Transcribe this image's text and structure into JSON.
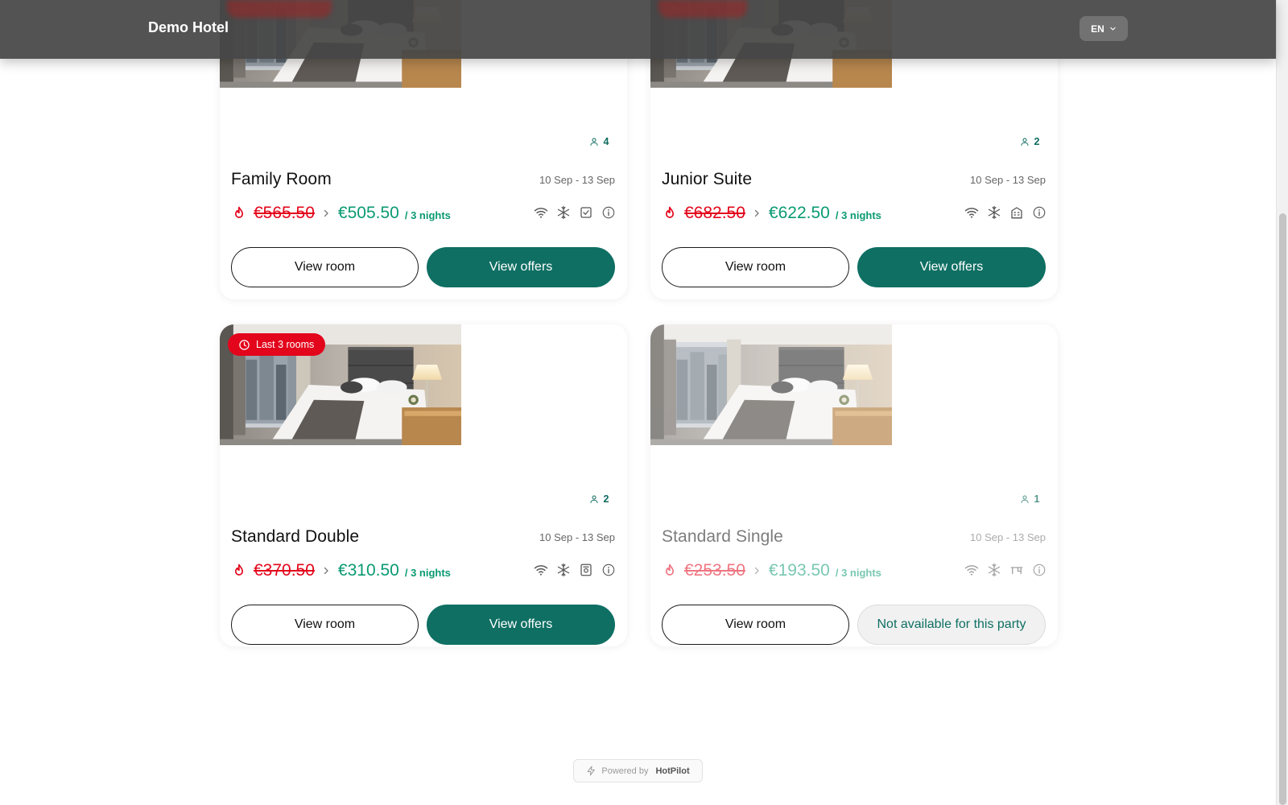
{
  "header": {
    "brand": "Demo Hotel",
    "language": "EN"
  },
  "colors": {
    "accent": "#0f6f63",
    "price_new": "#0a9a72",
    "price_old": "#e3051b",
    "badge": "#e3051b",
    "header_bg": "#464646"
  },
  "rooms": [
    {
      "title": "Family Room",
      "dates": "10 Sep - 13 Sep",
      "old_price": "€565.50",
      "new_price": "€505.50",
      "nights": "/ 3 nights",
      "guests": "4",
      "amenities": [
        "wifi-icon",
        "snowflake-icon",
        "checkbox-icon",
        "info-icon"
      ],
      "view_label": "View room",
      "action_label": "View offers",
      "available": true
    },
    {
      "title": "Junior Suite",
      "dates": "10 Sep - 13 Sep",
      "old_price": "€682.50",
      "new_price": "€622.50",
      "nights": "/ 3 nights",
      "guests": "2",
      "amenities": [
        "wifi-icon",
        "snowflake-icon",
        "building-icon",
        "info-icon"
      ],
      "view_label": "View room",
      "action_label": "View offers",
      "available": true
    },
    {
      "title": "Standard Double",
      "dates": "10 Sep - 13 Sep",
      "old_price": "€370.50",
      "new_price": "€310.50",
      "nights": "/ 3 nights",
      "guests": "2",
      "badge": "Last 3 rooms",
      "amenities": [
        "wifi-icon",
        "snowflake-icon",
        "safe-icon",
        "info-icon"
      ],
      "view_label": "View room",
      "action_label": "View offers",
      "available": true
    },
    {
      "title": "Standard Single",
      "dates": "10 Sep - 13 Sep",
      "old_price": "€253.50",
      "new_price": "€193.50",
      "nights": "/ 3 nights",
      "guests": "1",
      "amenities": [
        "wifi-icon",
        "snowflake-icon",
        "desk-icon",
        "info-icon"
      ],
      "view_label": "View room",
      "action_label": "Not available for this party",
      "available": false
    }
  ],
  "footer": {
    "powered_by": "Powered by",
    "brand": "HotPilot"
  }
}
